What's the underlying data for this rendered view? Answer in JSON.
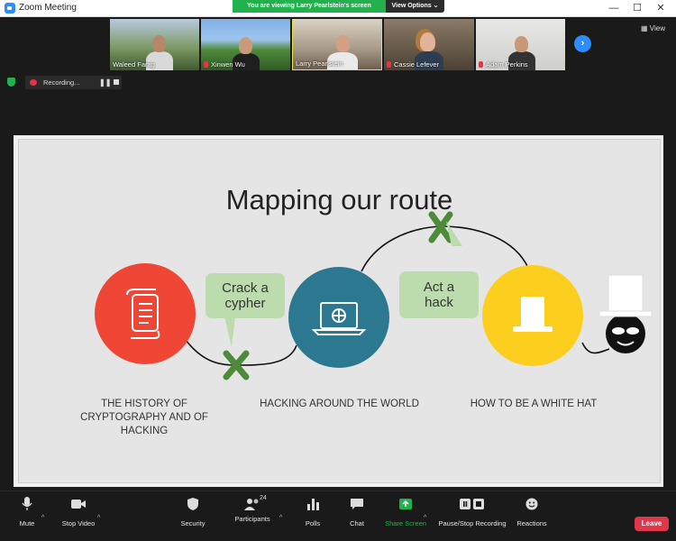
{
  "window": {
    "title": "Zoom Meeting",
    "banner": "You are viewing Larry Pearlstein's screen",
    "view_options": "View Options",
    "view_label": "View"
  },
  "participants": [
    {
      "name": "Waleed Farag",
      "muted": false
    },
    {
      "name": "Xinwen Wu",
      "muted": true
    },
    {
      "name": "Larry Pearlstein",
      "muted": false
    },
    {
      "name": "Cassie Lefever",
      "muted": true
    },
    {
      "name": "Adam Perkins",
      "muted": true
    }
  ],
  "recording": {
    "label": "Recording..."
  },
  "slide": {
    "title": "Mapping our route",
    "bubbles": {
      "crack": "Crack a\ncypher",
      "act": "Act a\nhack"
    },
    "captions": {
      "history": "THE HISTORY OF CRYPTOGRAPHY AND OF HACKING",
      "world": "HACKING AROUND THE WORLD",
      "whitehat": "HOW TO BE A WHITE HAT"
    },
    "colors": {
      "red": "#ef4635",
      "teal": "#2c7890",
      "yellow": "#fcce1d",
      "green_bubble": "#bcdcad",
      "green_x": "#4d8a3a"
    }
  },
  "toolbar": {
    "mute": "Mute",
    "stop_video": "Stop Video",
    "security": "Security",
    "participants": "Participants",
    "participants_count": "24",
    "polls": "Polls",
    "chat": "Chat",
    "share_screen": "Share Screen",
    "recording": "Pause/Stop Recording",
    "reactions": "Reactions",
    "leave": "Leave"
  },
  "colors": {
    "brand": "#2d8cff",
    "green": "#23b14d",
    "red": "#e0364a",
    "background": "#1a1a1a"
  }
}
